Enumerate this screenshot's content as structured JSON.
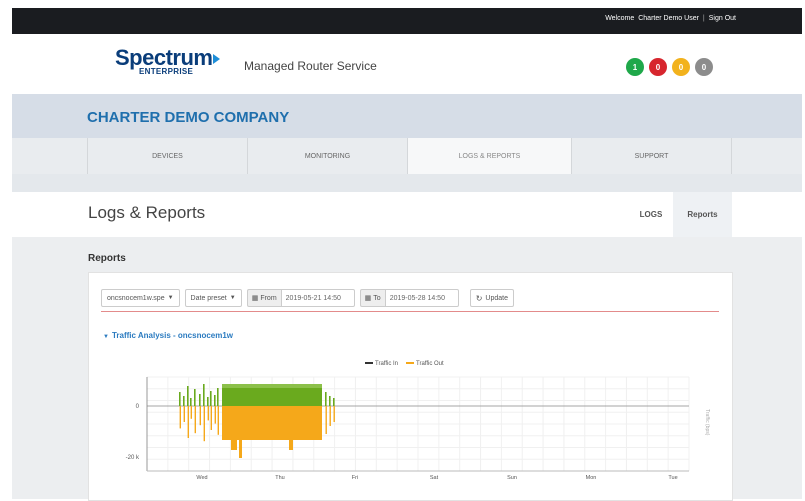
{
  "topbar": {
    "welcome": "Welcome",
    "user": "Charter Demo User",
    "separator": "|",
    "signout": "Sign Out"
  },
  "header": {
    "logo": {
      "word": "Spectrum",
      "sub": "ENTERPRISE"
    },
    "service": "Managed Router Service",
    "status_dots": [
      {
        "label": "1",
        "color": "#1fa84a"
      },
      {
        "label": "0",
        "color": "#d7262e"
      },
      {
        "label": "0",
        "color": "#f2b21d"
      },
      {
        "label": "0",
        "color": "#8c8c8c"
      }
    ]
  },
  "company": {
    "name": "CHARTER DEMO COMPANY"
  },
  "nav": {
    "tabs": [
      {
        "label": "DEVICES"
      },
      {
        "label": "MONITORING"
      },
      {
        "label": "LOGS & REPORTS",
        "active": true
      },
      {
        "label": "SUPPORT"
      }
    ]
  },
  "page": {
    "title": "Logs & Reports",
    "subtabs": [
      {
        "label": "LOGS"
      },
      {
        "label": "Reports",
        "active": true
      }
    ]
  },
  "reports": {
    "heading": "Reports",
    "device_select": "oncsnocem1w.spe",
    "date_preset": "Date preset",
    "from_label": "From",
    "from_value": "2019-05-21 14:50",
    "to_label": "To",
    "to_value": "2019-05-28 14:50",
    "update": "Update"
  },
  "section": {
    "title": "Traffic Analysis - oncsnocem1w"
  },
  "chart_data": {
    "type": "area",
    "series": [
      {
        "name": "Traffic In",
        "color": "#6aaa1e"
      },
      {
        "name": "Traffic Out",
        "color": "#f5a81a"
      }
    ],
    "categories": [
      "Wed",
      "Thu",
      "Fri",
      "Sat",
      "Sun",
      "Mon",
      "Tue"
    ],
    "y_ticks": [
      "0",
      "-20 k"
    ],
    "right_label": "Traffic (bps)"
  }
}
